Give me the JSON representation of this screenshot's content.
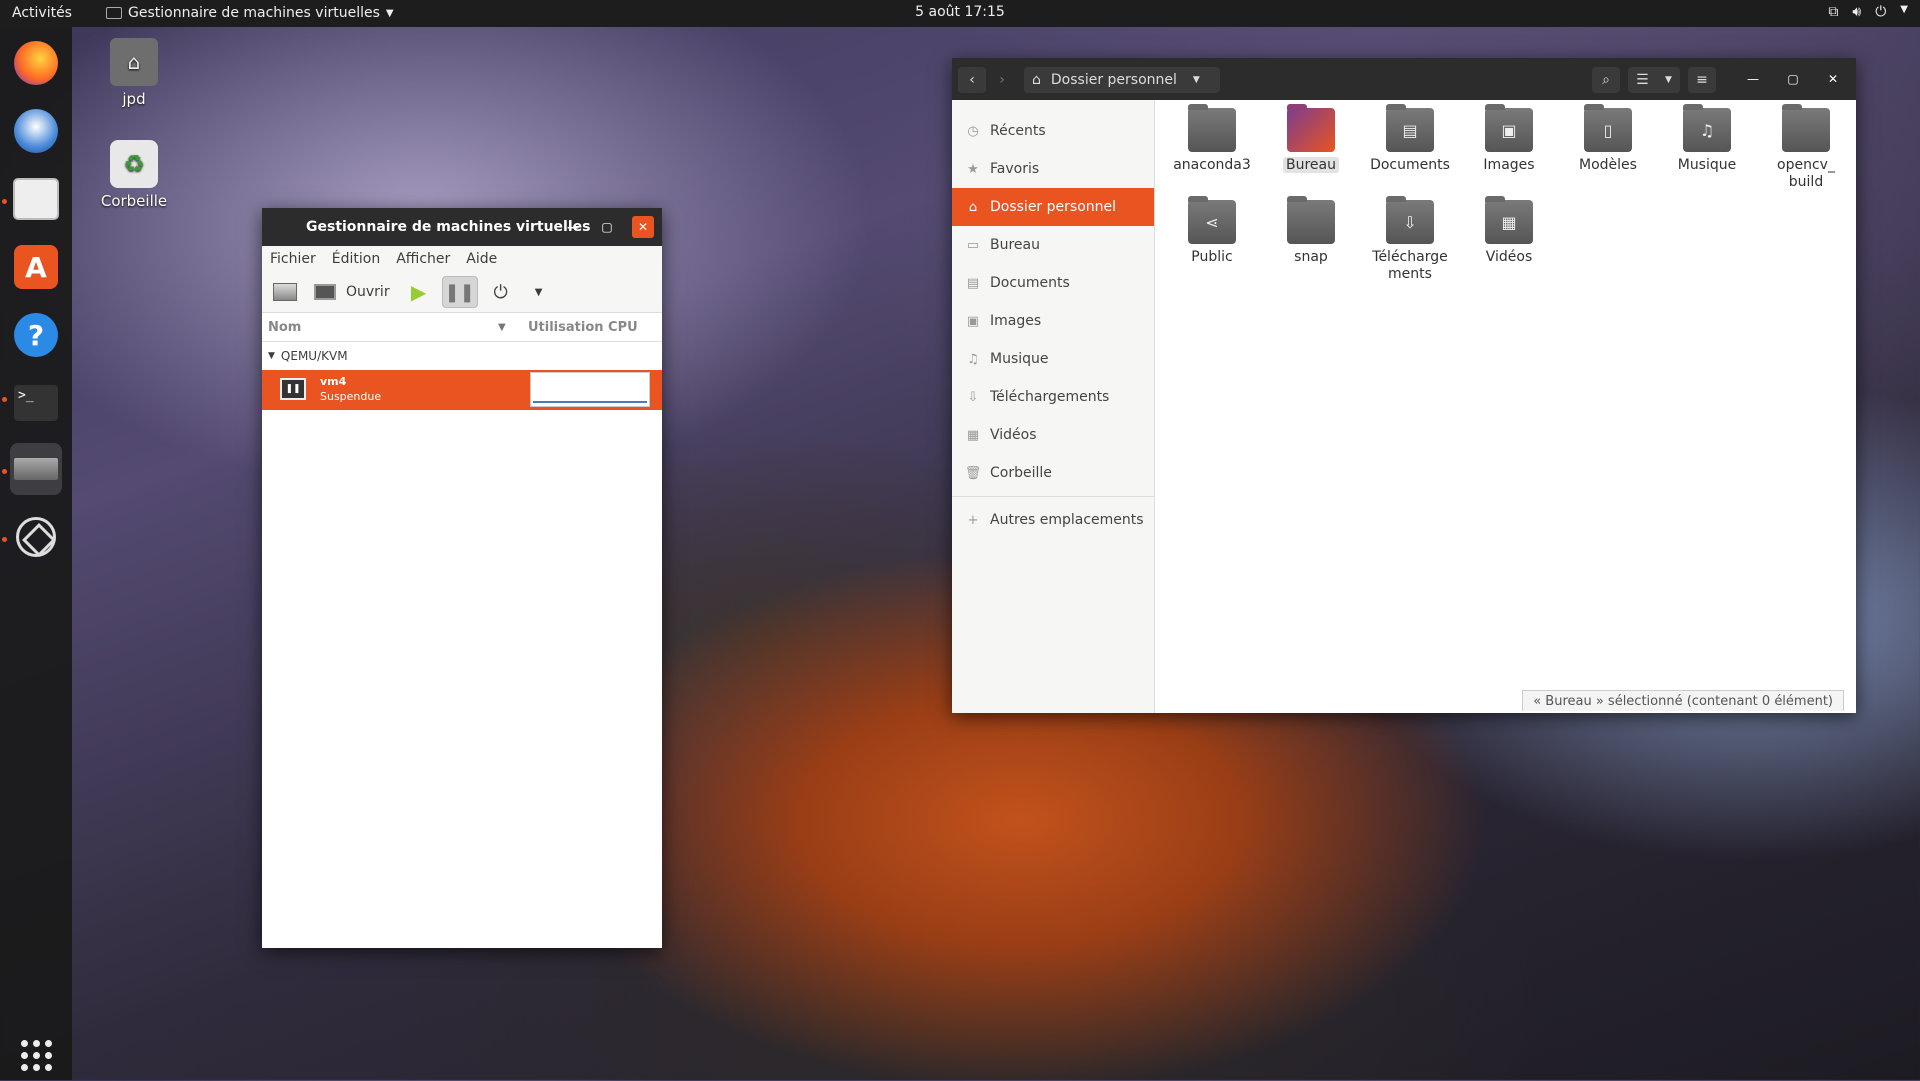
{
  "topbar": {
    "activities": "Activités",
    "app_name": "Gestionnaire de machines virtuelles",
    "clock": "5 août  17:15"
  },
  "desktop": {
    "home_label": "jpd",
    "trash_label": "Corbeille"
  },
  "vm_manager": {
    "title": "Gestionnaire de machines virtuelles",
    "menu": [
      "Fichier",
      "Édition",
      "Afficher",
      "Aide"
    ],
    "open_label": "Ouvrir",
    "col_name": "Nom",
    "col_cpu": "Utilisation CPU",
    "group": "QEMU/KVM",
    "vm_name": "vm4",
    "vm_status": "Suspendue"
  },
  "files": {
    "location": "Dossier personnel",
    "sidebar": [
      {
        "label": "Récents",
        "icon": "clock-icon"
      },
      {
        "label": "Favoris",
        "icon": "star-icon"
      },
      {
        "label": "Dossier personnel",
        "icon": "home-icon"
      },
      {
        "label": "Bureau",
        "icon": "folder-icon"
      },
      {
        "label": "Documents",
        "icon": "document-icon"
      },
      {
        "label": "Images",
        "icon": "image-icon"
      },
      {
        "label": "Musique",
        "icon": "music-icon"
      },
      {
        "label": "Téléchargements",
        "icon": "download-icon"
      },
      {
        "label": "Vidéos",
        "icon": "video-icon"
      },
      {
        "label": "Corbeille",
        "icon": "trash-icon"
      },
      {
        "label": "Autres emplacements",
        "icon": "plus-icon"
      }
    ],
    "items": [
      {
        "name": "anaconda3"
      },
      {
        "name": "Bureau"
      },
      {
        "name": "Documents"
      },
      {
        "name": "Images"
      },
      {
        "name": "Modèles"
      },
      {
        "name": "Musique"
      },
      {
        "name": "opencv_ build"
      },
      {
        "name": "Public"
      },
      {
        "name": "snap"
      },
      {
        "name": "Télécharge ments"
      },
      {
        "name": "Vidéos"
      }
    ],
    "status": "« Bureau » sélectionné  (contenant 0 élément)"
  },
  "colors": {
    "accent": "#e95420",
    "titlebar": "#2c2c2c"
  }
}
